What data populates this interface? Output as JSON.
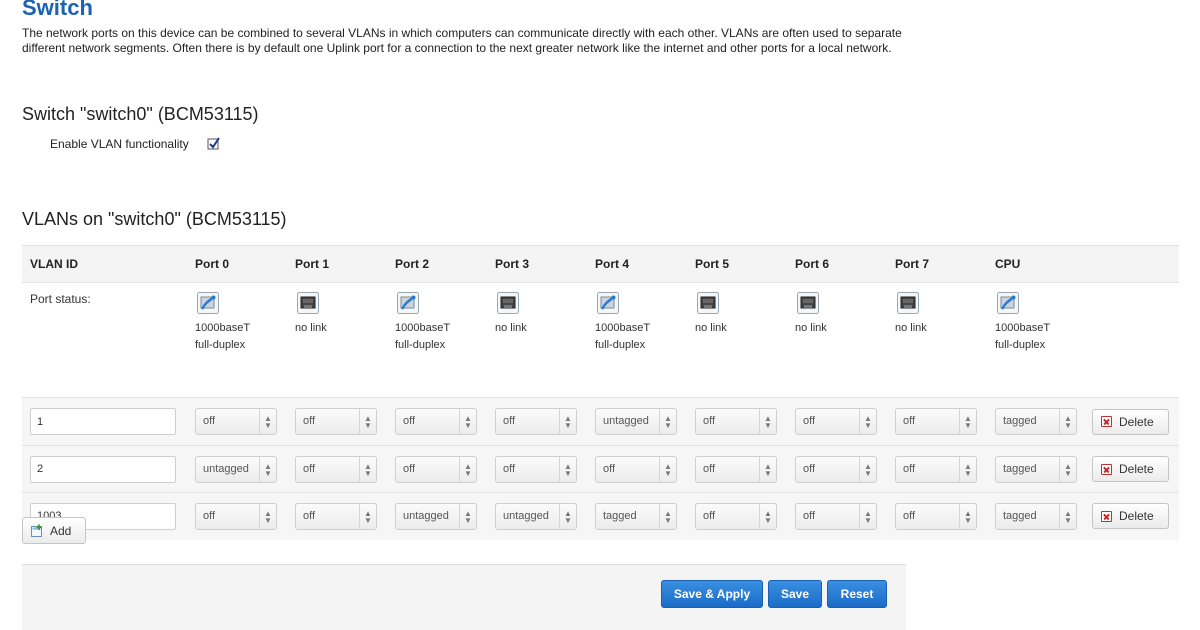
{
  "page": {
    "title": "Switch",
    "description": "The network ports on this device can be combined to several VLANs in which computers can communicate directly with each other. VLANs are often used to separate different network segments. Often there is by default one Uplink port for a connection to the next greater network like the internet and other ports for a local network."
  },
  "switch": {
    "title": "Switch \"switch0\" (BCM53115)",
    "enable_vlan_label": "Enable VLAN functionality",
    "enable_vlan_checked": true
  },
  "vlans": {
    "title": "VLANs on \"switch0\" (BCM53115)",
    "headers": [
      "VLAN ID",
      "Port 0",
      "Port 1",
      "Port 2",
      "Port 3",
      "Port 4",
      "Port 5",
      "Port 6",
      "Port 7",
      "CPU"
    ],
    "port_status_label": "Port status:",
    "port_status": [
      {
        "icon": "ethernet-active-icon",
        "line1": "1000baseT",
        "line2": "full-duplex"
      },
      {
        "icon": "ethernet-inactive-icon",
        "line1": "no link",
        "line2": ""
      },
      {
        "icon": "ethernet-active-icon",
        "line1": "1000baseT",
        "line2": "full-duplex"
      },
      {
        "icon": "ethernet-inactive-icon",
        "line1": "no link",
        "line2": ""
      },
      {
        "icon": "ethernet-active-icon",
        "line1": "1000baseT",
        "line2": "full-duplex"
      },
      {
        "icon": "ethernet-inactive-icon",
        "line1": "no link",
        "line2": ""
      },
      {
        "icon": "ethernet-inactive-icon",
        "line1": "no link",
        "line2": ""
      },
      {
        "icon": "ethernet-inactive-icon",
        "line1": "no link",
        "line2": ""
      },
      {
        "icon": "ethernet-active-icon",
        "line1": "1000baseT",
        "line2": "full-duplex"
      }
    ],
    "rows": [
      {
        "vlan_id": "1",
        "ports": [
          "off",
          "off",
          "off",
          "off",
          "untagged",
          "off",
          "off",
          "off",
          "tagged"
        ]
      },
      {
        "vlan_id": "2",
        "ports": [
          "untagged",
          "off",
          "off",
          "off",
          "off",
          "off",
          "off",
          "off",
          "tagged"
        ]
      },
      {
        "vlan_id": "1003",
        "ports": [
          "off",
          "off",
          "untagged",
          "untagged",
          "tagged",
          "off",
          "off",
          "off",
          "tagged"
        ]
      }
    ],
    "delete_label": "Delete",
    "add_label": "Add"
  },
  "footer": {
    "save_apply_label": "Save & Apply",
    "save_label": "Save",
    "reset_label": "Reset"
  },
  "colors": {
    "title_blue": "#1a62b3",
    "button_blue": "#1b6cc8"
  }
}
